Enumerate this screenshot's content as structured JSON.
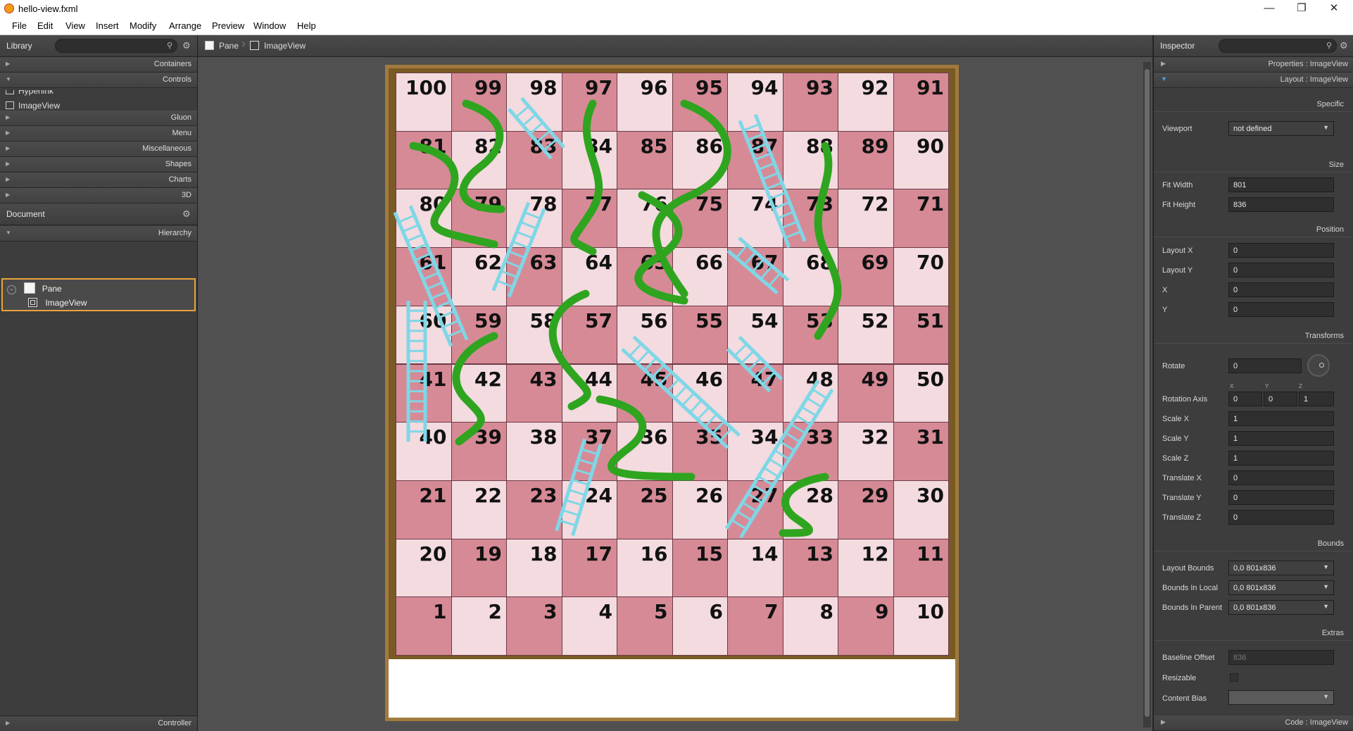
{
  "window": {
    "title": "hello-view.fxml",
    "controls": [
      "—",
      "❐",
      "✕"
    ]
  },
  "menu": [
    "File",
    "Edit",
    "View",
    "Insert",
    "Modify",
    "Arrange",
    "Preview",
    "Window",
    "Help"
  ],
  "library": {
    "title": "Library",
    "search_placeholder": "",
    "sections": [
      "Containers",
      "Controls",
      "Gluon",
      "Menu",
      "Miscellaneous",
      "Shapes",
      "Charts",
      "3D"
    ],
    "controls_items": [
      "Hyperlink",
      "ImageView"
    ]
  },
  "document": {
    "title": "Document",
    "hierarchy_label": "Hierarchy",
    "nodes": [
      "Pane",
      "ImageView"
    ],
    "controller_label": "Controller"
  },
  "breadcrumb": [
    "Pane",
    "ImageView"
  ],
  "board": {
    "numbers": [
      [
        100,
        99,
        98,
        97,
        96,
        95,
        94,
        93,
        92,
        91
      ],
      [
        81,
        82,
        83,
        84,
        85,
        86,
        87,
        88,
        89,
        90
      ],
      [
        80,
        79,
        78,
        77,
        76,
        75,
        74,
        73,
        72,
        71
      ],
      [
        61,
        62,
        63,
        64,
        65,
        66,
        67,
        68,
        69,
        70
      ],
      [
        60,
        59,
        58,
        57,
        56,
        55,
        54,
        53,
        52,
        51
      ],
      [
        41,
        42,
        43,
        44,
        45,
        46,
        47,
        48,
        49,
        50
      ],
      [
        40,
        39,
        38,
        37,
        36,
        35,
        34,
        33,
        32,
        31
      ],
      [
        21,
        22,
        23,
        24,
        25,
        26,
        27,
        28,
        29,
        30
      ],
      [
        20,
        19,
        18,
        17,
        16,
        15,
        14,
        13,
        12,
        11
      ],
      [
        1,
        2,
        3,
        4,
        5,
        6,
        7,
        8,
        9,
        10
      ]
    ],
    "colors": {
      "pink": "#d68a96",
      "light": "#f3dbe0",
      "snake": "#2fa51f",
      "ladder": "#7fd7e6"
    }
  },
  "inspector": {
    "title": "Inspector",
    "properties_label": "Properties : ImageView",
    "layout_label": "Layout : ImageView",
    "code_label": "Code : ImageView",
    "categories": {
      "specific": "Specific",
      "size": "Size",
      "position": "Position",
      "transforms": "Transforms",
      "bounds": "Bounds",
      "extras": "Extras"
    },
    "props": {
      "viewport_label": "Viewport",
      "viewport": "not defined",
      "fit_width_label": "Fit Width",
      "fit_width": "801",
      "fit_height_label": "Fit Height",
      "fit_height": "836",
      "layout_x_label": "Layout X",
      "layout_x": "0",
      "layout_y_label": "Layout Y",
      "layout_y": "0",
      "x_label": "X",
      "x": "0",
      "y_label": "Y",
      "y": "0",
      "rotate_label": "Rotate",
      "rotate": "0",
      "rotation_axis_label": "Rotation Axis",
      "rot_x": "0",
      "rot_y": "0",
      "rot_z": "1",
      "axis_x": "X",
      "axis_y": "Y",
      "axis_z": "Z",
      "scale_x_label": "Scale X",
      "scale_x": "1",
      "scale_y_label": "Scale Y",
      "scale_y": "1",
      "scale_z_label": "Scale Z",
      "scale_z": "1",
      "translate_x_label": "Translate X",
      "translate_x": "0",
      "translate_y_label": "Translate Y",
      "translate_y": "0",
      "translate_z_label": "Translate Z",
      "translate_z": "0",
      "layout_bounds_label": "Layout Bounds",
      "layout_bounds": "0,0  801x836",
      "bounds_local_label": "Bounds In Local",
      "bounds_local": "0,0  801x836",
      "bounds_parent_label": "Bounds In Parent",
      "bounds_parent": "0,0  801x836",
      "baseline_label": "Baseline Offset",
      "baseline": "836",
      "resizable_label": "Resizable",
      "content_bias_label": "Content Bias"
    }
  }
}
